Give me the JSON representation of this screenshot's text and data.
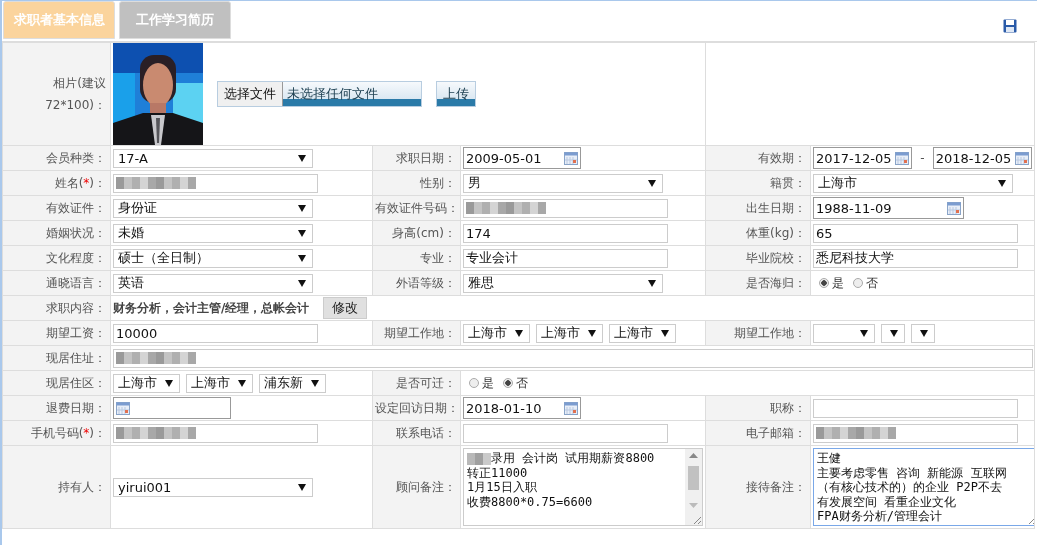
{
  "tabs": [
    {
      "label": "求职者基本信息",
      "selected": true
    },
    {
      "label": "工作学习简历",
      "selected": false
    }
  ],
  "photo": {
    "label": "相片(建议72*100)：",
    "file_button": "选择文件",
    "file_status": "未选择任何文件",
    "upload_button": "上传"
  },
  "rows": [
    {
      "cells": [
        {
          "label": "会员种类：",
          "field": {
            "kind": "select",
            "value": "17-A"
          }
        },
        {
          "label": "求职日期：",
          "field": {
            "kind": "date",
            "value": "2009-05-01"
          }
        },
        {
          "label": "有效期：",
          "field": {
            "kind": "daterange",
            "from": "2017-12-05",
            "separator": "-",
            "to": "2018-12-05"
          }
        }
      ]
    },
    {
      "cells": [
        {
          "label": "姓名(",
          "mark": "*",
          "label_tail": ")：",
          "field": {
            "kind": "input",
            "redacted": true
          }
        },
        {
          "label": "性别：",
          "field": {
            "kind": "select",
            "value": "男"
          }
        },
        {
          "label": "籍贯：",
          "field": {
            "kind": "select",
            "value": "上海市"
          }
        }
      ]
    },
    {
      "cells": [
        {
          "label": "有效证件：",
          "field": {
            "kind": "select",
            "value": "身份证"
          }
        },
        {
          "label": "有效证件号码：",
          "field": {
            "kind": "input",
            "redacted": true
          }
        },
        {
          "label": "出生日期：",
          "field": {
            "kind": "date",
            "value": "1988-11-09"
          }
        }
      ]
    },
    {
      "cells": [
        {
          "label": "婚姻状况：",
          "field": {
            "kind": "select",
            "value": "未婚"
          }
        },
        {
          "label": "身高(cm)：",
          "field": {
            "kind": "input",
            "value": "174"
          }
        },
        {
          "label": "体重(kg)：",
          "field": {
            "kind": "input",
            "value": "65"
          }
        }
      ]
    },
    {
      "cells": [
        {
          "label": "文化程度：",
          "field": {
            "kind": "select",
            "value": "硕士（全日制）"
          }
        },
        {
          "label": "专业：",
          "field": {
            "kind": "input",
            "value": "专业会计"
          }
        },
        {
          "label": "毕业院校：",
          "field": {
            "kind": "input",
            "value": "悉尼科技大学"
          }
        }
      ]
    },
    {
      "cells": [
        {
          "label": "通晓语言：",
          "field": {
            "kind": "select",
            "value": "英语"
          }
        },
        {
          "label": "外语等级：",
          "field": {
            "kind": "select",
            "value": "雅思"
          }
        },
        {
          "label": "是否海归：",
          "field": {
            "kind": "radio",
            "options": [
              {
                "label": "是",
                "selected": true
              },
              {
                "label": "否",
                "selected": false
              }
            ]
          }
        }
      ]
    },
    {
      "cells": [
        {
          "label": "求职内容：",
          "field": {
            "kind": "text_button",
            "text": "财务分析，会计主管/经理，总帐会计",
            "button": "修改"
          }
        }
      ]
    },
    {
      "cells": [
        {
          "label": "期望工资：",
          "field": {
            "kind": "input",
            "value": "10000"
          }
        },
        {
          "label": "期望工作地：",
          "field": {
            "kind": "selects",
            "items": [
              {
                "kind": "select",
                "value": "上海市"
              },
              {
                "kind": "select",
                "value": "上海市"
              },
              {
                "kind": "select",
                "value": "上海市"
              }
            ]
          }
        },
        {
          "label": "期望工作地：",
          "field": {
            "kind": "selects",
            "items": [
              {
                "kind": "select"
              },
              {
                "kind": "select"
              },
              {
                "kind": "select"
              }
            ]
          }
        }
      ]
    },
    {
      "cells": [
        {
          "label": "现居住址：",
          "field": {
            "kind": "input",
            "redacted": true
          }
        }
      ]
    },
    {
      "cells": [
        {
          "label": "现居住区：",
          "field": {
            "kind": "selects",
            "items": [
              {
                "kind": "select",
                "value": "上海市"
              },
              {
                "kind": "select",
                "value": "上海市"
              },
              {
                "kind": "select",
                "value": "浦东新"
              }
            ]
          }
        },
        {
          "label": "是否可迁：",
          "field": {
            "kind": "radio",
            "options": [
              {
                "label": "是",
                "selected": false
              },
              {
                "label": "否",
                "selected": true
              }
            ]
          }
        }
      ]
    },
    {
      "cells": [
        {
          "label": "退费日期：",
          "field": {
            "kind": "date"
          }
        },
        {
          "label": "设定回访日期：",
          "field": {
            "kind": "date",
            "value": "2018-01-10"
          }
        },
        {
          "label": "职称：",
          "field": {
            "kind": "input"
          }
        }
      ]
    },
    {
      "cells": [
        {
          "label": "手机号码(",
          "mark": "*",
          "label_tail": ")：",
          "field": {
            "kind": "input",
            "redacted": true
          }
        },
        {
          "label": "联系电话：",
          "field": {
            "kind": "input"
          }
        },
        {
          "label": "电子邮箱：",
          "field": {
            "kind": "input",
            "redacted": true
          }
        }
      ]
    },
    {
      "cells": [
        {
          "label": "持有人：",
          "field": {
            "kind": "select",
            "value": "yirui001"
          }
        },
        {
          "label": "顾问备注：",
          "field": {
            "kind": "textarea",
            "redacted_prefix": true,
            "scrollbar": true,
            "focused": false,
            "lines": [
              "录用  会计岗  试用期薪资8800",
              "转正11000",
              "1月15日入职",
              "收费8800*0.75=6600"
            ]
          }
        },
        {
          "label": "接待备注：",
          "field": {
            "kind": "textarea",
            "focused": true,
            "lines": [
              "王健",
              "主要考虑零售 咨询 新能源 互联网",
              "（有核心技术的）的企业 P2P不去",
              "有发展空间 看重企业文化",
              "FPA财务分析/管理会计"
            ]
          }
        }
      ]
    }
  ]
}
